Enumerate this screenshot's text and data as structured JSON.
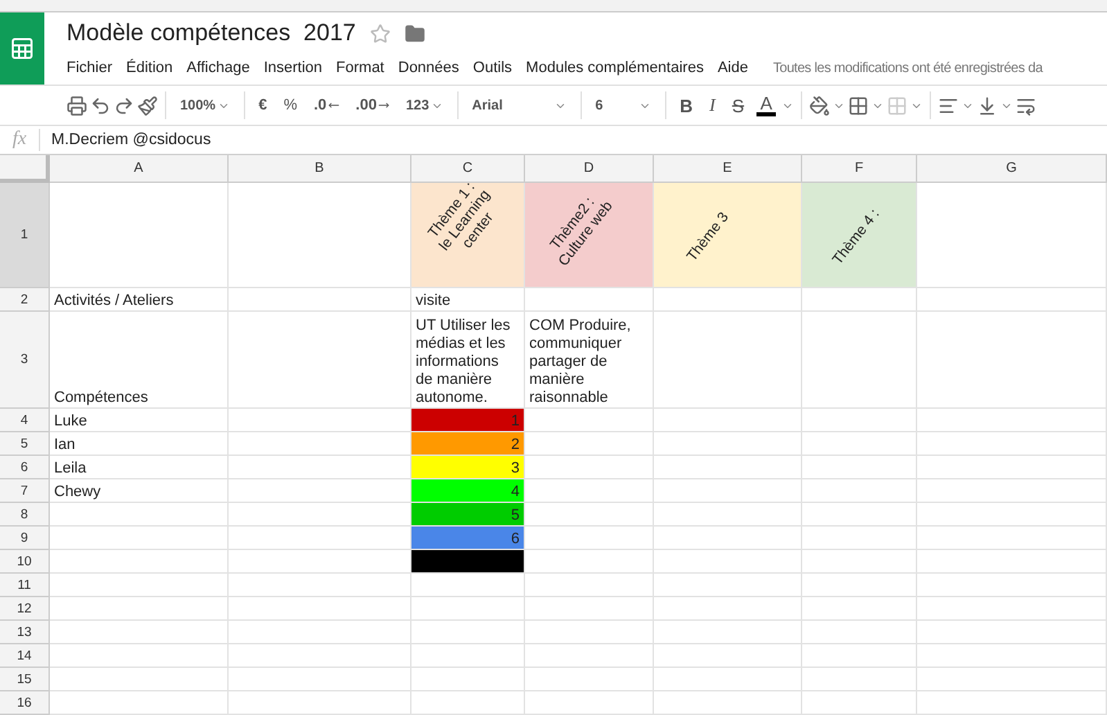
{
  "document": {
    "title": "Modèle compétences  2017",
    "starred": false
  },
  "menu": [
    "Fichier",
    "Édition",
    "Affichage",
    "Insertion",
    "Format",
    "Données",
    "Outils",
    "Modules complémentaires",
    "Aide"
  ],
  "save_status": "Toutes les modifications ont été enregistrées da",
  "toolbar": {
    "zoom": "100%",
    "currency": "€",
    "percent": "%",
    "decrease_decimals": ".0",
    "increase_decimals": ".00",
    "number_format": "123",
    "font": "Arial",
    "font_size": "6",
    "bold": "B",
    "italic": "I",
    "strikethrough": "S",
    "text_color": "A"
  },
  "formula_bar": {
    "label": "fx",
    "value": "M.Decriem @csidocus"
  },
  "columns": [
    "A",
    "B",
    "C",
    "D",
    "E",
    "F",
    "G"
  ],
  "rows": [
    {
      "number": "1",
      "selected": true,
      "cells": [
        {},
        {},
        {
          "text": "Thème 1 :\nle Learning center",
          "kind": "rotated",
          "color": "#fce5cd"
        },
        {
          "text": "Thème2 : Culture web",
          "kind": "rotated",
          "color": "#f4cccc"
        },
        {
          "text": "Thème 3",
          "kind": "rotated",
          "color": "#fff2cc"
        },
        {
          "text": "Thème 4 :",
          "kind": "rotated",
          "color": "#d9ead3"
        },
        {}
      ]
    },
    {
      "number": "2",
      "selected": false,
      "cells": [
        {
          "text": "Activités / Ateliers"
        },
        {},
        {
          "text": "visite"
        },
        {},
        {},
        {},
        {}
      ]
    },
    {
      "number": "3",
      "selected": false,
      "cells": [
        {
          "text": "Compétences"
        },
        {},
        {
          "text": "UT Utiliser les médias et les informations de manière autonome."
        },
        {
          "text": "COM Produire, communiquer partager de manière raisonnable"
        },
        {},
        {},
        {}
      ]
    },
    {
      "number": "4",
      "selected": false,
      "cells": [
        {
          "text": "Luke"
        },
        {},
        {
          "text": "1",
          "kind": "number",
          "color": "#cc0000"
        },
        {},
        {},
        {},
        {}
      ]
    },
    {
      "number": "5",
      "selected": false,
      "cells": [
        {
          "text": "Ian"
        },
        {},
        {
          "text": "2",
          "kind": "number",
          "color": "#ff9900"
        },
        {},
        {},
        {},
        {}
      ]
    },
    {
      "number": "6",
      "selected": false,
      "cells": [
        {
          "text": "Leila"
        },
        {},
        {
          "text": "3",
          "kind": "number",
          "color": "#ffff00"
        },
        {},
        {},
        {},
        {}
      ]
    },
    {
      "number": "7",
      "selected": false,
      "cells": [
        {
          "text": "Chewy"
        },
        {},
        {
          "text": "4",
          "kind": "number",
          "color": "#00ff00"
        },
        {},
        {},
        {},
        {}
      ]
    },
    {
      "number": "8",
      "selected": false,
      "cells": [
        {},
        {},
        {
          "text": "5",
          "kind": "number",
          "color": "#00cc00"
        },
        {},
        {},
        {},
        {}
      ]
    },
    {
      "number": "9",
      "selected": false,
      "cells": [
        {},
        {},
        {
          "text": "6",
          "kind": "number",
          "color": "#4a86e8"
        },
        {},
        {},
        {},
        {}
      ]
    },
    {
      "number": "10",
      "selected": false,
      "cells": [
        {},
        {},
        {
          "color": "#000000"
        },
        {},
        {},
        {},
        {}
      ]
    },
    {
      "number": "11",
      "selected": false,
      "cells": [
        {},
        {},
        {},
        {},
        {},
        {},
        {}
      ]
    },
    {
      "number": "12",
      "selected": false,
      "cells": [
        {},
        {},
        {},
        {},
        {},
        {},
        {}
      ]
    },
    {
      "number": "13",
      "selected": false,
      "cells": [
        {},
        {},
        {},
        {},
        {},
        {},
        {}
      ]
    },
    {
      "number": "14",
      "selected": false,
      "cells": [
        {},
        {},
        {},
        {},
        {},
        {},
        {}
      ]
    },
    {
      "number": "15",
      "selected": false,
      "cells": [
        {},
        {},
        {},
        {},
        {},
        {},
        {}
      ]
    },
    {
      "number": "16",
      "selected": false,
      "cells": [
        {},
        {},
        {},
        {},
        {},
        {},
        {}
      ]
    }
  ]
}
